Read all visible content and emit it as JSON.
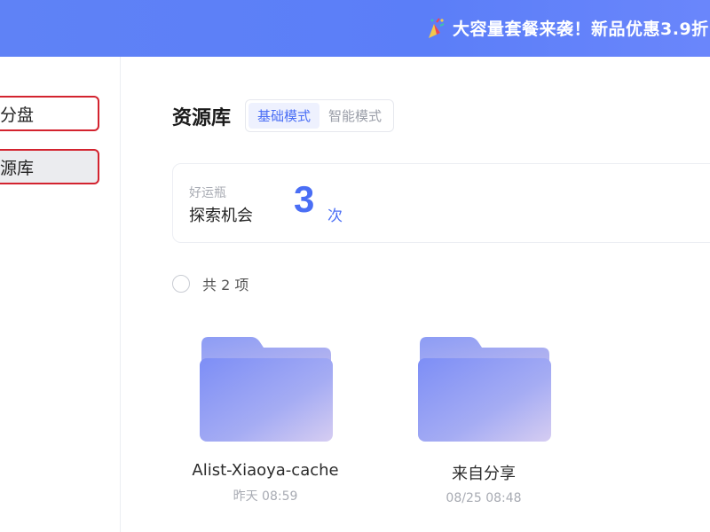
{
  "banner": {
    "text": "大容量套餐来袭！新品优惠3.9折",
    "icon": "party-popper-icon"
  },
  "sidebar": {
    "items": [
      {
        "label": "分盘"
      },
      {
        "label": "源库"
      }
    ]
  },
  "header": {
    "title": "资源库",
    "modes": [
      "基础模式",
      "智能模式"
    ]
  },
  "card": {
    "small_label": "好运瓶",
    "main_label": "探索机会",
    "count": "3",
    "unit": "次"
  },
  "list": {
    "count_text": "共 2 项",
    "items": [
      {
        "name": "Alist-Xiaoya-cache",
        "time": "昨天 08:59"
      },
      {
        "name": "来自分享",
        "time": "08/25 08:48"
      }
    ]
  },
  "colors": {
    "accent": "#4a6ef5",
    "banner": "#5f82f6",
    "highlight_border": "#d3232f"
  }
}
